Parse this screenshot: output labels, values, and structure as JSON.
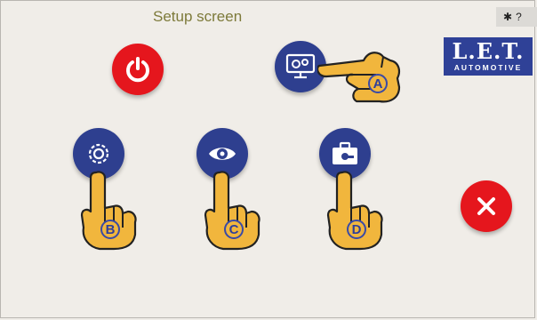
{
  "header": {
    "title": "Setup screen"
  },
  "status": {
    "bluetooth_symbol": "✱",
    "text": "?"
  },
  "logo": {
    "main": "L.E.T.",
    "sub": "AUTOMOTIVE"
  },
  "buttons": {
    "power": {
      "icon": "power-icon"
    },
    "display_settings": {
      "icon": "monitor-gears-icon",
      "callout": "A"
    },
    "settings": {
      "icon": "gear-icon",
      "callout": "B"
    },
    "view": {
      "icon": "eye-icon",
      "callout": "C"
    },
    "tools": {
      "icon": "toolbox-icon",
      "callout": "D"
    },
    "close": {
      "icon": "close-icon"
    }
  },
  "colors": {
    "primary_blue": "#2e3f8f",
    "danger_red": "#e5161d",
    "hand_orange": "#f1b63d",
    "title_olive": "#7d7a3a"
  }
}
